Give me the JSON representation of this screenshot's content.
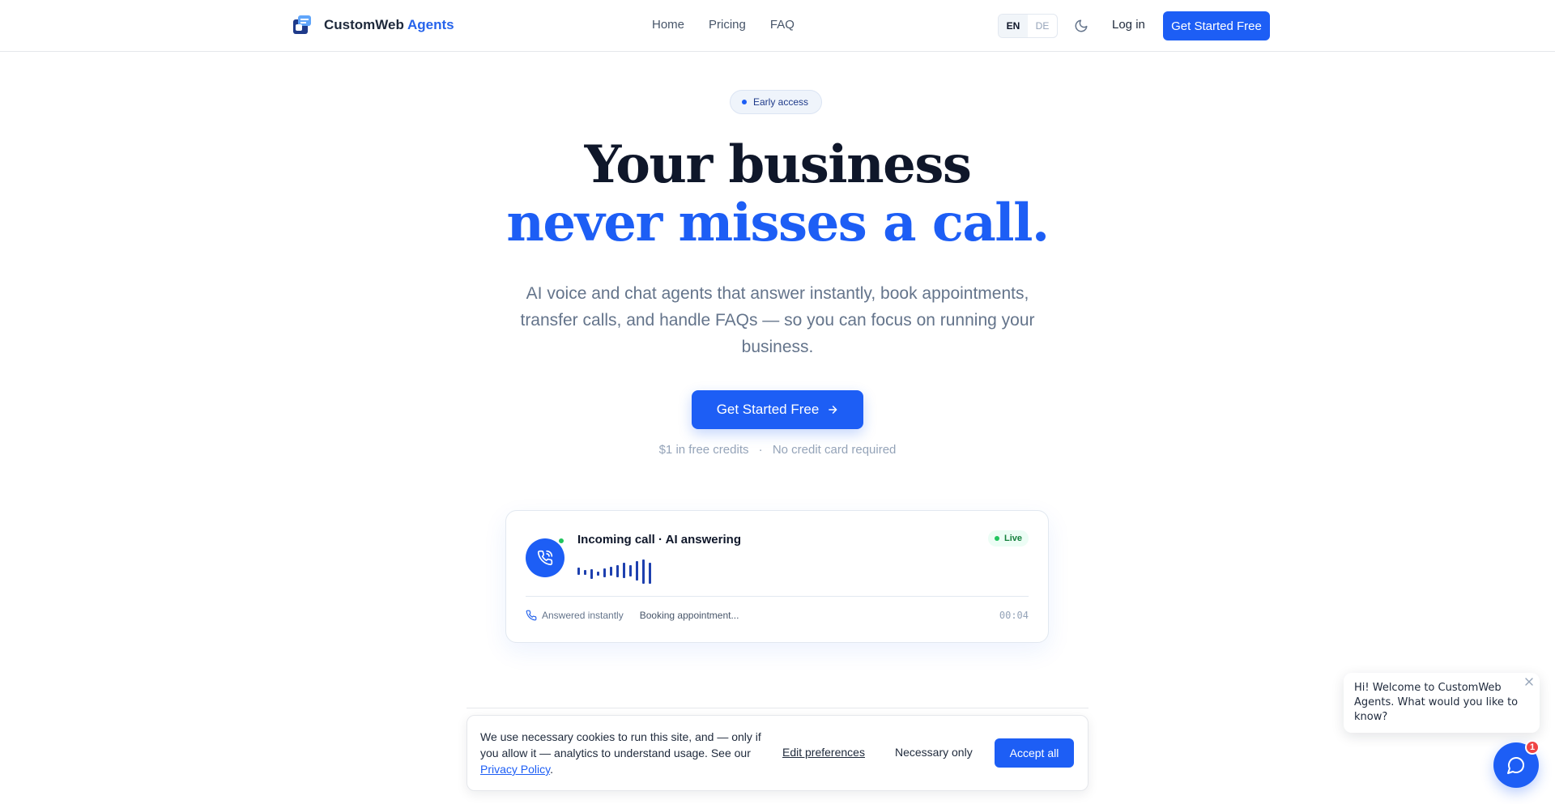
{
  "header": {
    "logo_text": "CustomWeb",
    "logo_accent": "Agents",
    "nav": [
      "Home",
      "Pricing",
      "FAQ"
    ],
    "lang": {
      "active": "EN",
      "other": "DE"
    },
    "theme_icon": "moon-icon",
    "login": "Log in",
    "cta": "Get Started Free"
  },
  "hero": {
    "badge": "Early access",
    "title_line1": "Your business",
    "title_line2": "never misses a call.",
    "subtitle": "AI voice and chat agents that answer instantly, book appointments, transfer calls, and handle FAQs — so you can focus on running your business.",
    "cta": "Get Started Free",
    "note_part1": "$1 in free credits",
    "note_sep": "·",
    "note_part2": "No credit card required"
  },
  "call_card": {
    "title": "Incoming call · AI answering",
    "status": "Live",
    "answered": "Answered instantly",
    "activity": "Booking appointment...",
    "timer": "00:04"
  },
  "cookie": {
    "text_before": "We use necessary cookies to run this site, and — only if you allow it — analytics to understand usage. See our ",
    "policy_link": "Privacy Policy",
    "text_after": ".",
    "edit": "Edit preferences",
    "necessary": "Necessary only",
    "accept": "Accept all"
  },
  "chat": {
    "greeting": "Hi! Welcome to CustomWeb Agents. What would you like to know?",
    "unread": "1"
  },
  "colors": {
    "primary": "#1d5ef5",
    "heading": "#0f172a",
    "muted": "#64748b",
    "live": "#22c55e",
    "badge_red": "#ef4444"
  }
}
